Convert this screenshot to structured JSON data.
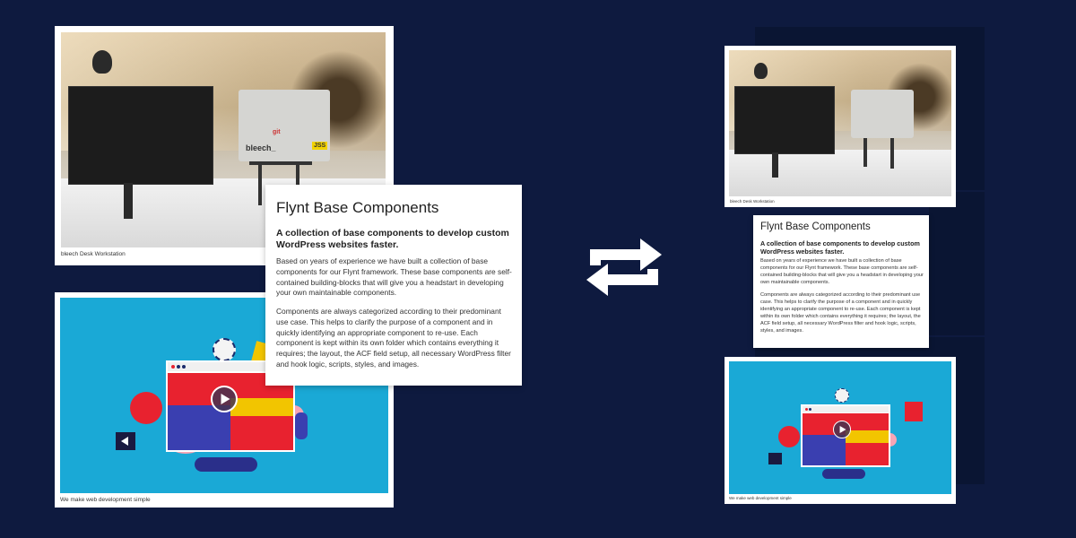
{
  "left": {
    "photo_caption": "bleech Desk Workstation",
    "illustration_caption": "We make web development simple",
    "stickers": [
      "bleech_",
      "git",
      "JSS"
    ],
    "content": {
      "title": "Flynt Base Components",
      "subtitle": "A collection of base components to develop custom WordPress websites faster.",
      "paragraph1": "Based on years of experience we have built a collection of base components for our Flynt framework. These base components are self-contained building-blocks that will give you a headstart in developing your own maintainable components.",
      "paragraph2": "Components are always categorized according to their predominant use case. This helps to clarify the purpose of a component and in quickly identifying an appropriate component to re-use. Each component is kept within its own folder which contains everything it requires; the layout, the ACF field setup, all necessary WordPress filter and hook logic, scripts, styles, and images."
    }
  },
  "right": {
    "photo_caption": "bleech Desk Workstation",
    "illustration_caption": "We make web development simple",
    "content": {
      "title": "Flynt Base Components",
      "subtitle": "A collection of base components to develop custom WordPress websites faster.",
      "paragraph1": "Based on years of experience we have built a collection of base components for our Flynt framework. These base components are self-contained building-blocks that will give you a headstart in developing your own maintainable components.",
      "paragraph2": "Components are always categorized according to their predominant use case. This helps to clarify the purpose of a component and in quickly identifying an appropriate component to re-use. Each component is kept within its own folder which contains everything it requires; the layout, the ACF field setup, all necessary WordPress filter and hook logic, scripts, styles, and images."
    }
  },
  "icons": {
    "center": "swap-arrows-icon"
  },
  "colors": {
    "background": "#0e1a3f",
    "illustration": "#1aa9d6",
    "arrows": "#ffffff"
  }
}
